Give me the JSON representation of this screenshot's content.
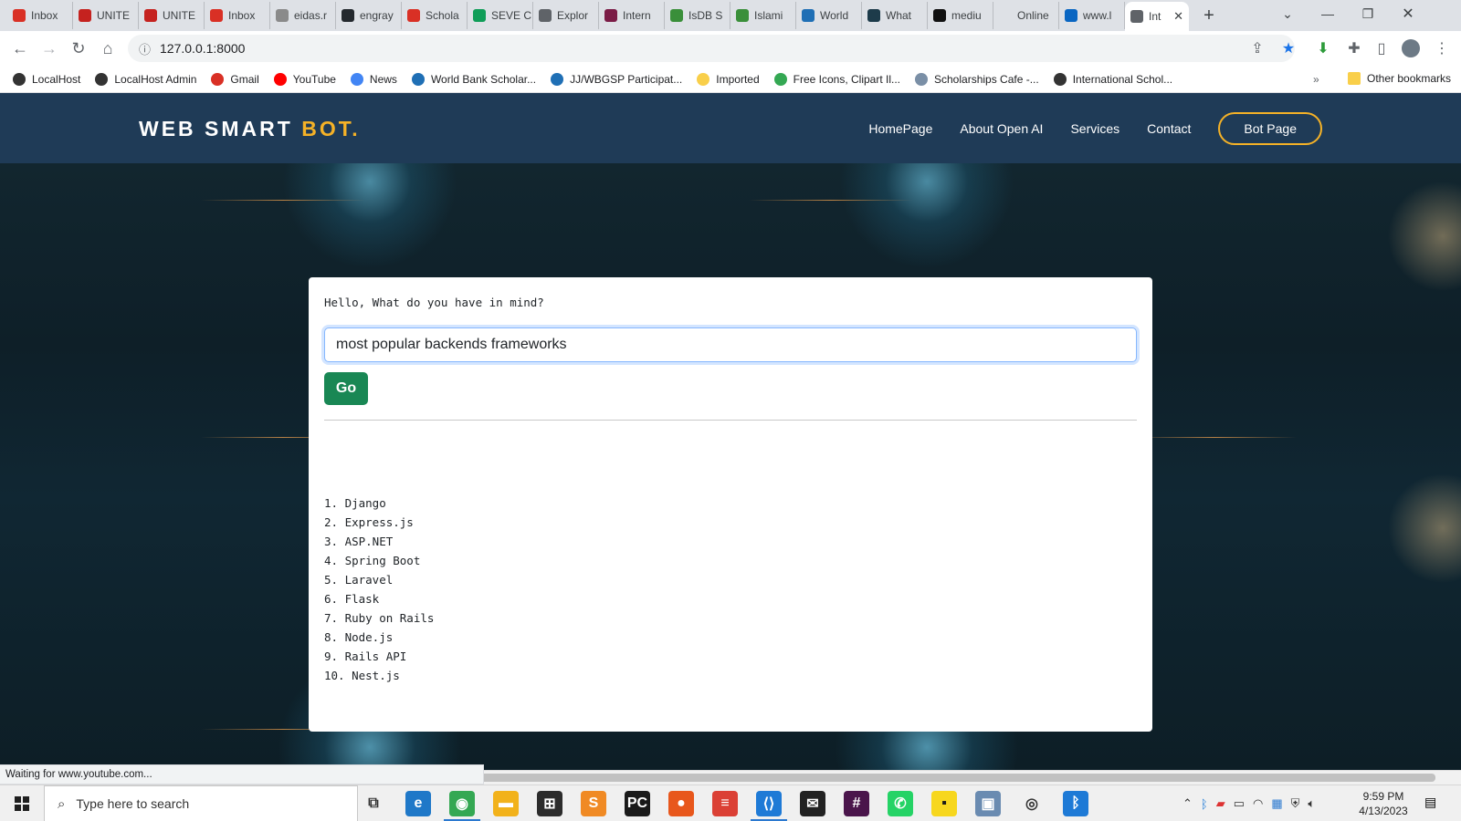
{
  "browser": {
    "tabs": [
      {
        "title": "Inbox",
        "icon": "gmail-icon",
        "color": "#d93025"
      },
      {
        "title": "UNITE",
        "icon": "unite-icon",
        "color": "#c5221f"
      },
      {
        "title": "UNITE",
        "icon": "unite-icon",
        "color": "#c5221f"
      },
      {
        "title": "Inbox",
        "icon": "gmail-icon",
        "color": "#d93025"
      },
      {
        "title": "eidas.r",
        "icon": "page-icon",
        "color": "#8a8a8a"
      },
      {
        "title": "engray",
        "icon": "github-icon",
        "color": "#24292e"
      },
      {
        "title": "Schola",
        "icon": "bars-icon",
        "color": "#d93025"
      },
      {
        "title": "SEVE C",
        "icon": "seve-icon",
        "color": "#0f9d58"
      },
      {
        "title": "Explor",
        "icon": "globe-icon",
        "color": "#5f6368"
      },
      {
        "title": "Intern",
        "icon": "u-icon",
        "color": "#7b1c46"
      },
      {
        "title": "IsDB S",
        "icon": "isdb-icon",
        "color": "#3a8f3a"
      },
      {
        "title": "Islami",
        "icon": "islami-icon",
        "color": "#3a8f3a"
      },
      {
        "title": "World",
        "icon": "world-icon",
        "color": "#1f6fb5"
      },
      {
        "title": "What",
        "icon": "what-icon",
        "color": "#1d3b4a"
      },
      {
        "title": "mediu",
        "icon": "medium-icon",
        "color": "#111111"
      },
      {
        "title": "Online",
        "icon": "blank-icon",
        "color": "#dee1e6"
      },
      {
        "title": "www.l",
        "icon": "linkedin-icon",
        "color": "#0a66c2"
      },
      {
        "title": "Int",
        "icon": "globe-icon",
        "color": "#5f6368",
        "active": true
      }
    ],
    "url": "127.0.0.1:8000",
    "bookmarks": [
      {
        "label": "LocalHost",
        "color": "#333333"
      },
      {
        "label": "LocalHost Admin",
        "color": "#333333"
      },
      {
        "label": "Gmail",
        "color": "#d93025"
      },
      {
        "label": "YouTube",
        "color": "#ff0000"
      },
      {
        "label": "News",
        "color": "#4285f4"
      },
      {
        "label": "World Bank Scholar...",
        "color": "#1f6fb5"
      },
      {
        "label": "JJ/WBGSP Participat...",
        "color": "#1f6fb5"
      },
      {
        "label": "Imported",
        "color": "#f9cf4a"
      },
      {
        "label": "Free Icons, Clipart Il...",
        "color": "#34a853"
      },
      {
        "label": "Scholarships Cafe -...",
        "color": "#7a8fa6"
      },
      {
        "label": "International Schol...",
        "color": "#333333"
      }
    ],
    "bookmarks_more": "»",
    "other_bookmarks": "Other bookmarks",
    "status_text": "Waiting for www.youtube.com..."
  },
  "site": {
    "logo_main": "WEB SMART ",
    "logo_accent": "BOT.",
    "nav": [
      "HomePage",
      "About Open AI",
      "Services",
      "Contact"
    ],
    "cta": "Bot Page",
    "accent_color": "#f5b227",
    "header_color": "#1f3b57"
  },
  "chat": {
    "prompt_label": "Hello, What do you have in mind?",
    "query_value": "most popular backends frameworks",
    "go_label": "Go",
    "go_color": "#198754",
    "answers": [
      "1. Django",
      "2. Express.js",
      "3. ASP.NET",
      "4. Spring Boot",
      "5. Laravel",
      "6. Flask",
      "7. Ruby on Rails",
      "8. Node.js",
      "9. Rails API",
      "10. Nest.js"
    ]
  },
  "taskbar": {
    "search_placeholder": "Type here to search",
    "time": "9:59 PM",
    "date": "4/13/2023",
    "apps": [
      {
        "name": "task-view-icon",
        "glyph": "⧉",
        "color": "#333333",
        "bg": "transparent"
      },
      {
        "name": "edge-icon",
        "glyph": "e",
        "color": "#ffffff",
        "bg": "#1f78c8"
      },
      {
        "name": "chrome-icon",
        "glyph": "◉",
        "color": "#ffffff",
        "bg": "#34a853",
        "active": true
      },
      {
        "name": "file-explorer-icon",
        "glyph": "▬",
        "color": "#ffffff",
        "bg": "#f2b21b"
      },
      {
        "name": "store-icon",
        "glyph": "⊞",
        "color": "#ffffff",
        "bg": "#2c2c2c"
      },
      {
        "name": "sublime-icon",
        "glyph": "S",
        "color": "#ffffff",
        "bg": "#f08a24"
      },
      {
        "name": "pycharm-icon",
        "glyph": "PC",
        "color": "#ffffff",
        "bg": "#1a1a1a"
      },
      {
        "name": "firefox-icon",
        "glyph": "●",
        "color": "#ffffff",
        "bg": "#e8571c"
      },
      {
        "name": "todoist-icon",
        "glyph": "≡",
        "color": "#ffffff",
        "bg": "#db4035"
      },
      {
        "name": "vscode-icon",
        "glyph": "⟨⟩",
        "color": "#ffffff",
        "bg": "#1e7ad6",
        "active": true
      },
      {
        "name": "mail-icon",
        "glyph": "✉",
        "color": "#ffffff",
        "bg": "#222222"
      },
      {
        "name": "slack-icon",
        "glyph": "#",
        "color": "#ffffff",
        "bg": "#4a154b"
      },
      {
        "name": "whatsapp-icon",
        "glyph": "✆",
        "color": "#ffffff",
        "bg": "#25d366"
      },
      {
        "name": "sticky-notes-icon",
        "glyph": "▪",
        "color": "#1a1a1a",
        "bg": "#f7d71e"
      },
      {
        "name": "photos-icon",
        "glyph": "▣",
        "color": "#ffffff",
        "bg": "#6a8bb1"
      },
      {
        "name": "media-icon",
        "glyph": "◎",
        "color": "#333333",
        "bg": "transparent"
      },
      {
        "name": "bluetooth-app-icon",
        "glyph": "ᛒ",
        "color": "#ffffff",
        "bg": "#1e7ad6"
      }
    ]
  }
}
